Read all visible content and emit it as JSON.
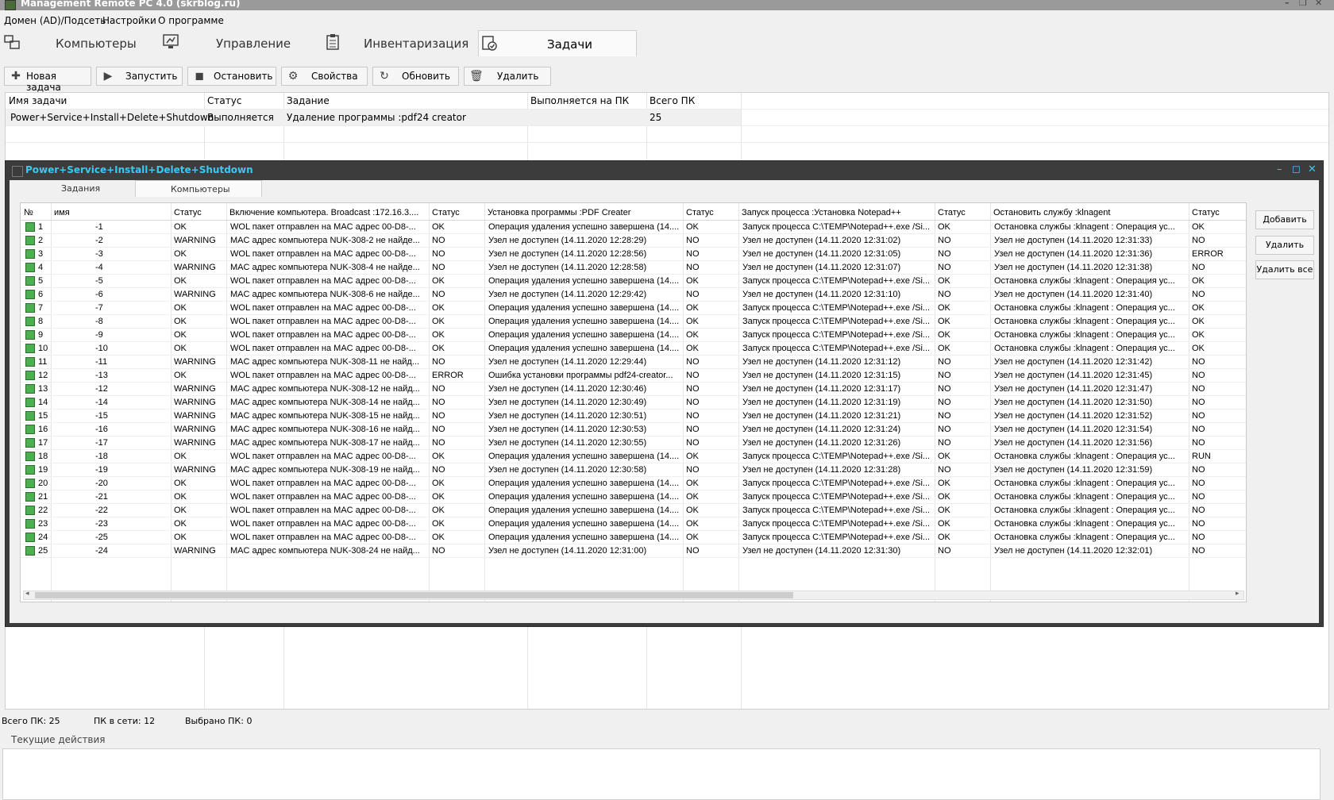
{
  "window": {
    "title": "Management Remote PC 4.0 (skrblog.ru)"
  },
  "menu": [
    "Домен (AD)/Подсеть",
    "Настройки",
    "О программе"
  ],
  "tabs": [
    {
      "label": "Компьютеры",
      "icon": "computers-icon"
    },
    {
      "label": "Управление",
      "icon": "monitor-control-icon"
    },
    {
      "label": "Инвентаризация",
      "icon": "clipboard-icon"
    },
    {
      "label": "Задачи",
      "icon": "tasks-check-icon",
      "active": true
    }
  ],
  "toolbar": {
    "new_task": "Новая задача",
    "run": "Запустить",
    "stop": "Остановить",
    "properties": "Свойства",
    "refresh": "Обновить",
    "delete": "Удалить"
  },
  "tasks_table": {
    "headers": [
      "Имя задачи",
      "Статус",
      "Задание",
      "Выполняется на ПК",
      "Всего ПК"
    ],
    "rows": [
      [
        "Power+Service+Install+Delete+Shutdown",
        "Выполняется",
        "Удаление программы :pdf24 creator",
        "",
        "25"
      ]
    ]
  },
  "child_window": {
    "title": "Power+Service+Install+Delete+Shutdown",
    "tabs": [
      "Задания",
      "Компьютеры"
    ],
    "headers": [
      "№",
      "имя",
      "Статус",
      "Включение компьютера. Broadcast :172.16.3....",
      "Статус",
      "Установка программы :PDF Creater",
      "Статус",
      "Запуск процесса :Установка Notepad++",
      "Статус",
      "Остановить службу :klnagent",
      "Статус"
    ],
    "buttons": {
      "add": "Добавить",
      "remove": "Удалить",
      "remove_all": "Удалить все"
    },
    "rows": [
      [
        "1",
        "-1",
        "OK",
        "WOL пакет отправлен на MAC адрес 00-D8-...",
        "OK",
        "Операция удаления успешно завершена (14....",
        "OK",
        "Запуск процесса C:\\TEMP\\Notepad++.exe /Si...",
        "OK",
        "Остановка службы :klnagent :  Операция ус...",
        "OK"
      ],
      [
        "2",
        "-2",
        "WARNING",
        "MAC адрес компьютера NUK-308-2 не найде...",
        "NO",
        "Узел не доступен (14.11.2020 12:28:29)",
        "NO",
        "Узел не доступен (14.11.2020 12:31:02)",
        "NO",
        "Узел не доступен (14.11.2020 12:31:33)",
        "NO"
      ],
      [
        "3",
        "-3",
        "OK",
        "WOL пакет отправлен на MAC адрес 00-D8-...",
        "NO",
        "Узел не доступен (14.11.2020 12:28:56)",
        "NO",
        "Узел не доступен (14.11.2020 12:31:05)",
        "NO",
        "Узел не доступен (14.11.2020 12:31:36)",
        "ERROR"
      ],
      [
        "4",
        "-4",
        "WARNING",
        "MAC адрес компьютера NUK-308-4 не найде...",
        "NO",
        "Узел не доступен (14.11.2020 12:28:58)",
        "NO",
        "Узел не доступен (14.11.2020 12:31:07)",
        "NO",
        "Узел не доступен (14.11.2020 12:31:38)",
        "NO"
      ],
      [
        "5",
        "-5",
        "OK",
        "WOL пакет отправлен на MAC адрес 00-D8-...",
        "OK",
        "Операция удаления успешно завершена (14....",
        "OK",
        "Запуск процесса C:\\TEMP\\Notepad++.exe /Si...",
        "OK",
        "Остановка службы :klnagent :  Операция ус...",
        "OK"
      ],
      [
        "6",
        "-6",
        "WARNING",
        "MAC адрес компьютера NUK-308-6 не найде...",
        "NO",
        "Узел не доступен (14.11.2020 12:29:42)",
        "NO",
        "Узел не доступен (14.11.2020 12:31:10)",
        "NO",
        "Узел не доступен (14.11.2020 12:31:40)",
        "NO"
      ],
      [
        "7",
        "-7",
        "OK",
        "WOL пакет отправлен на MAC адрес 00-D8-...",
        "OK",
        "Операция удаления успешно завершена (14....",
        "OK",
        "Запуск процесса C:\\TEMP\\Notepad++.exe /Si...",
        "OK",
        "Остановка службы :klnagent :  Операция ус...",
        "OK"
      ],
      [
        "8",
        "-8",
        "OK",
        "WOL пакет отправлен на MAC адрес 00-D8-...",
        "OK",
        "Операция удаления успешно завершена (14....",
        "OK",
        "Запуск процесса C:\\TEMP\\Notepad++.exe /Si...",
        "OK",
        "Остановка службы :klnagent :  Операция ус...",
        "OK"
      ],
      [
        "9",
        "-9",
        "OK",
        "WOL пакет отправлен на MAC адрес 00-D8-...",
        "OK",
        "Операция удаления успешно завершена (14....",
        "OK",
        "Запуск процесса C:\\TEMP\\Notepad++.exe /Si...",
        "OK",
        "Остановка службы :klnagent :  Операция ус...",
        "OK"
      ],
      [
        "10",
        "-10",
        "OK",
        "WOL пакет отправлен на MAC адрес 00-D8-...",
        "OK",
        "Операция удаления успешно завершена (14....",
        "OK",
        "Запуск процесса C:\\TEMP\\Notepad++.exe /Si...",
        "OK",
        "Остановка службы :klnagent :  Операция ус...",
        "OK"
      ],
      [
        "11",
        "-11",
        "WARNING",
        "MAC адрес компьютера NUK-308-11 не найд...",
        "NO",
        "Узел не доступен (14.11.2020 12:29:44)",
        "NO",
        "Узел не доступен (14.11.2020 12:31:12)",
        "NO",
        "Узел не доступен (14.11.2020 12:31:42)",
        "NO"
      ],
      [
        "12",
        "-13",
        "OK",
        "WOL пакет отправлен на MAC адрес 00-D8-...",
        "ERROR",
        "Ошибка установки программы pdf24-creator...",
        "NO",
        "Узел не доступен (14.11.2020 12:31:15)",
        "NO",
        "Узел не доступен (14.11.2020 12:31:45)",
        "NO"
      ],
      [
        "13",
        "-12",
        "WARNING",
        "MAC адрес компьютера NUK-308-12 не найд...",
        "NO",
        "Узел не доступен (14.11.2020 12:30:46)",
        "NO",
        "Узел не доступен (14.11.2020 12:31:17)",
        "NO",
        "Узел не доступен (14.11.2020 12:31:47)",
        "NO"
      ],
      [
        "14",
        "-14",
        "WARNING",
        "MAC адрес компьютера NUK-308-14 не найд...",
        "NO",
        "Узел не доступен (14.11.2020 12:30:49)",
        "NO",
        "Узел не доступен (14.11.2020 12:31:19)",
        "NO",
        "Узел не доступен (14.11.2020 12:31:50)",
        "NO"
      ],
      [
        "15",
        "-15",
        "WARNING",
        "MAC адрес компьютера NUK-308-15 не найд...",
        "NO",
        "Узел не доступен (14.11.2020 12:30:51)",
        "NO",
        "Узел не доступен (14.11.2020 12:31:21)",
        "NO",
        "Узел не доступен (14.11.2020 12:31:52)",
        "NO"
      ],
      [
        "16",
        "-16",
        "WARNING",
        "MAC адрес компьютера NUK-308-16 не найд...",
        "NO",
        "Узел не доступен (14.11.2020 12:30:53)",
        "NO",
        "Узел не доступен (14.11.2020 12:31:24)",
        "NO",
        "Узел не доступен (14.11.2020 12:31:54)",
        "NO"
      ],
      [
        "17",
        "-17",
        "WARNING",
        "MAC адрес компьютера NUK-308-17 не найд...",
        "NO",
        "Узел не доступен (14.11.2020 12:30:55)",
        "NO",
        "Узел не доступен (14.11.2020 12:31:26)",
        "NO",
        "Узел не доступен (14.11.2020 12:31:56)",
        "NO"
      ],
      [
        "18",
        "-18",
        "OK",
        "WOL пакет отправлен на MAC адрес 00-D8-...",
        "OK",
        "Операция удаления успешно завершена (14....",
        "OK",
        "Запуск процесса C:\\TEMP\\Notepad++.exe /Si...",
        "OK",
        "Остановка службы :klnagent :  Операция ус...",
        "RUN"
      ],
      [
        "19",
        "-19",
        "WARNING",
        "MAC адрес компьютера NUK-308-19 не найд...",
        "NO",
        "Узел не доступен (14.11.2020 12:30:58)",
        "NO",
        "Узел не доступен (14.11.2020 12:31:28)",
        "NO",
        "Узел не доступен (14.11.2020 12:31:59)",
        "NO"
      ],
      [
        "20",
        "-20",
        "OK",
        "WOL пакет отправлен на MAC адрес 00-D8-...",
        "OK",
        "Операция удаления успешно завершена (14....",
        "OK",
        "Запуск процесса C:\\TEMP\\Notepad++.exe /Si...",
        "OK",
        "Остановка службы :klnagent :  Операция ус...",
        "NO"
      ],
      [
        "21",
        "-21",
        "OK",
        "WOL пакет отправлен на MAC адрес 00-D8-...",
        "OK",
        "Операция удаления успешно завершена (14....",
        "OK",
        "Запуск процесса C:\\TEMP\\Notepad++.exe /Si...",
        "OK",
        "Остановка службы :klnagent :  Операция ус...",
        "NO"
      ],
      [
        "22",
        "-22",
        "OK",
        "WOL пакет отправлен на MAC адрес 00-D8-...",
        "OK",
        "Операция удаления успешно завершена (14....",
        "OK",
        "Запуск процесса C:\\TEMP\\Notepad++.exe /Si...",
        "OK",
        "Остановка службы :klnagent :  Операция ус...",
        "NO"
      ],
      [
        "23",
        "-23",
        "OK",
        "WOL пакет отправлен на MAC адрес 00-D8-...",
        "OK",
        "Операция удаления успешно завершена (14....",
        "OK",
        "Запуск процесса C:\\TEMP\\Notepad++.exe /Si...",
        "OK",
        "Остановка службы :klnagent :  Операция ус...",
        "NO"
      ],
      [
        "24",
        "-25",
        "OK",
        "WOL пакет отправлен на MAC адрес 00-D8-...",
        "OK",
        "Операция удаления успешно завершена (14....",
        "OK",
        "Запуск процесса C:\\TEMP\\Notepad++.exe /Si...",
        "OK",
        "Остановка службы :klnagent :  Операция ус...",
        "NO"
      ],
      [
        "25",
        "-24",
        "WARNING",
        "MAC адрес компьютера NUK-308-24 не найд...",
        "NO",
        "Узел не доступен (14.11.2020 12:31:00)",
        "NO",
        "Узел не доступен (14.11.2020 12:31:30)",
        "NO",
        "Узел не доступен (14.11.2020 12:32:01)",
        "NO"
      ]
    ]
  },
  "status": {
    "total": "Всего ПК: 25",
    "online": "ПК в сети: 12",
    "selected": "Выбрано ПК: 0"
  },
  "actions": {
    "legend": "Текущие действия"
  },
  "colors": {
    "child_title": "#3cc8f0",
    "pc_icon": "#4caf50"
  }
}
